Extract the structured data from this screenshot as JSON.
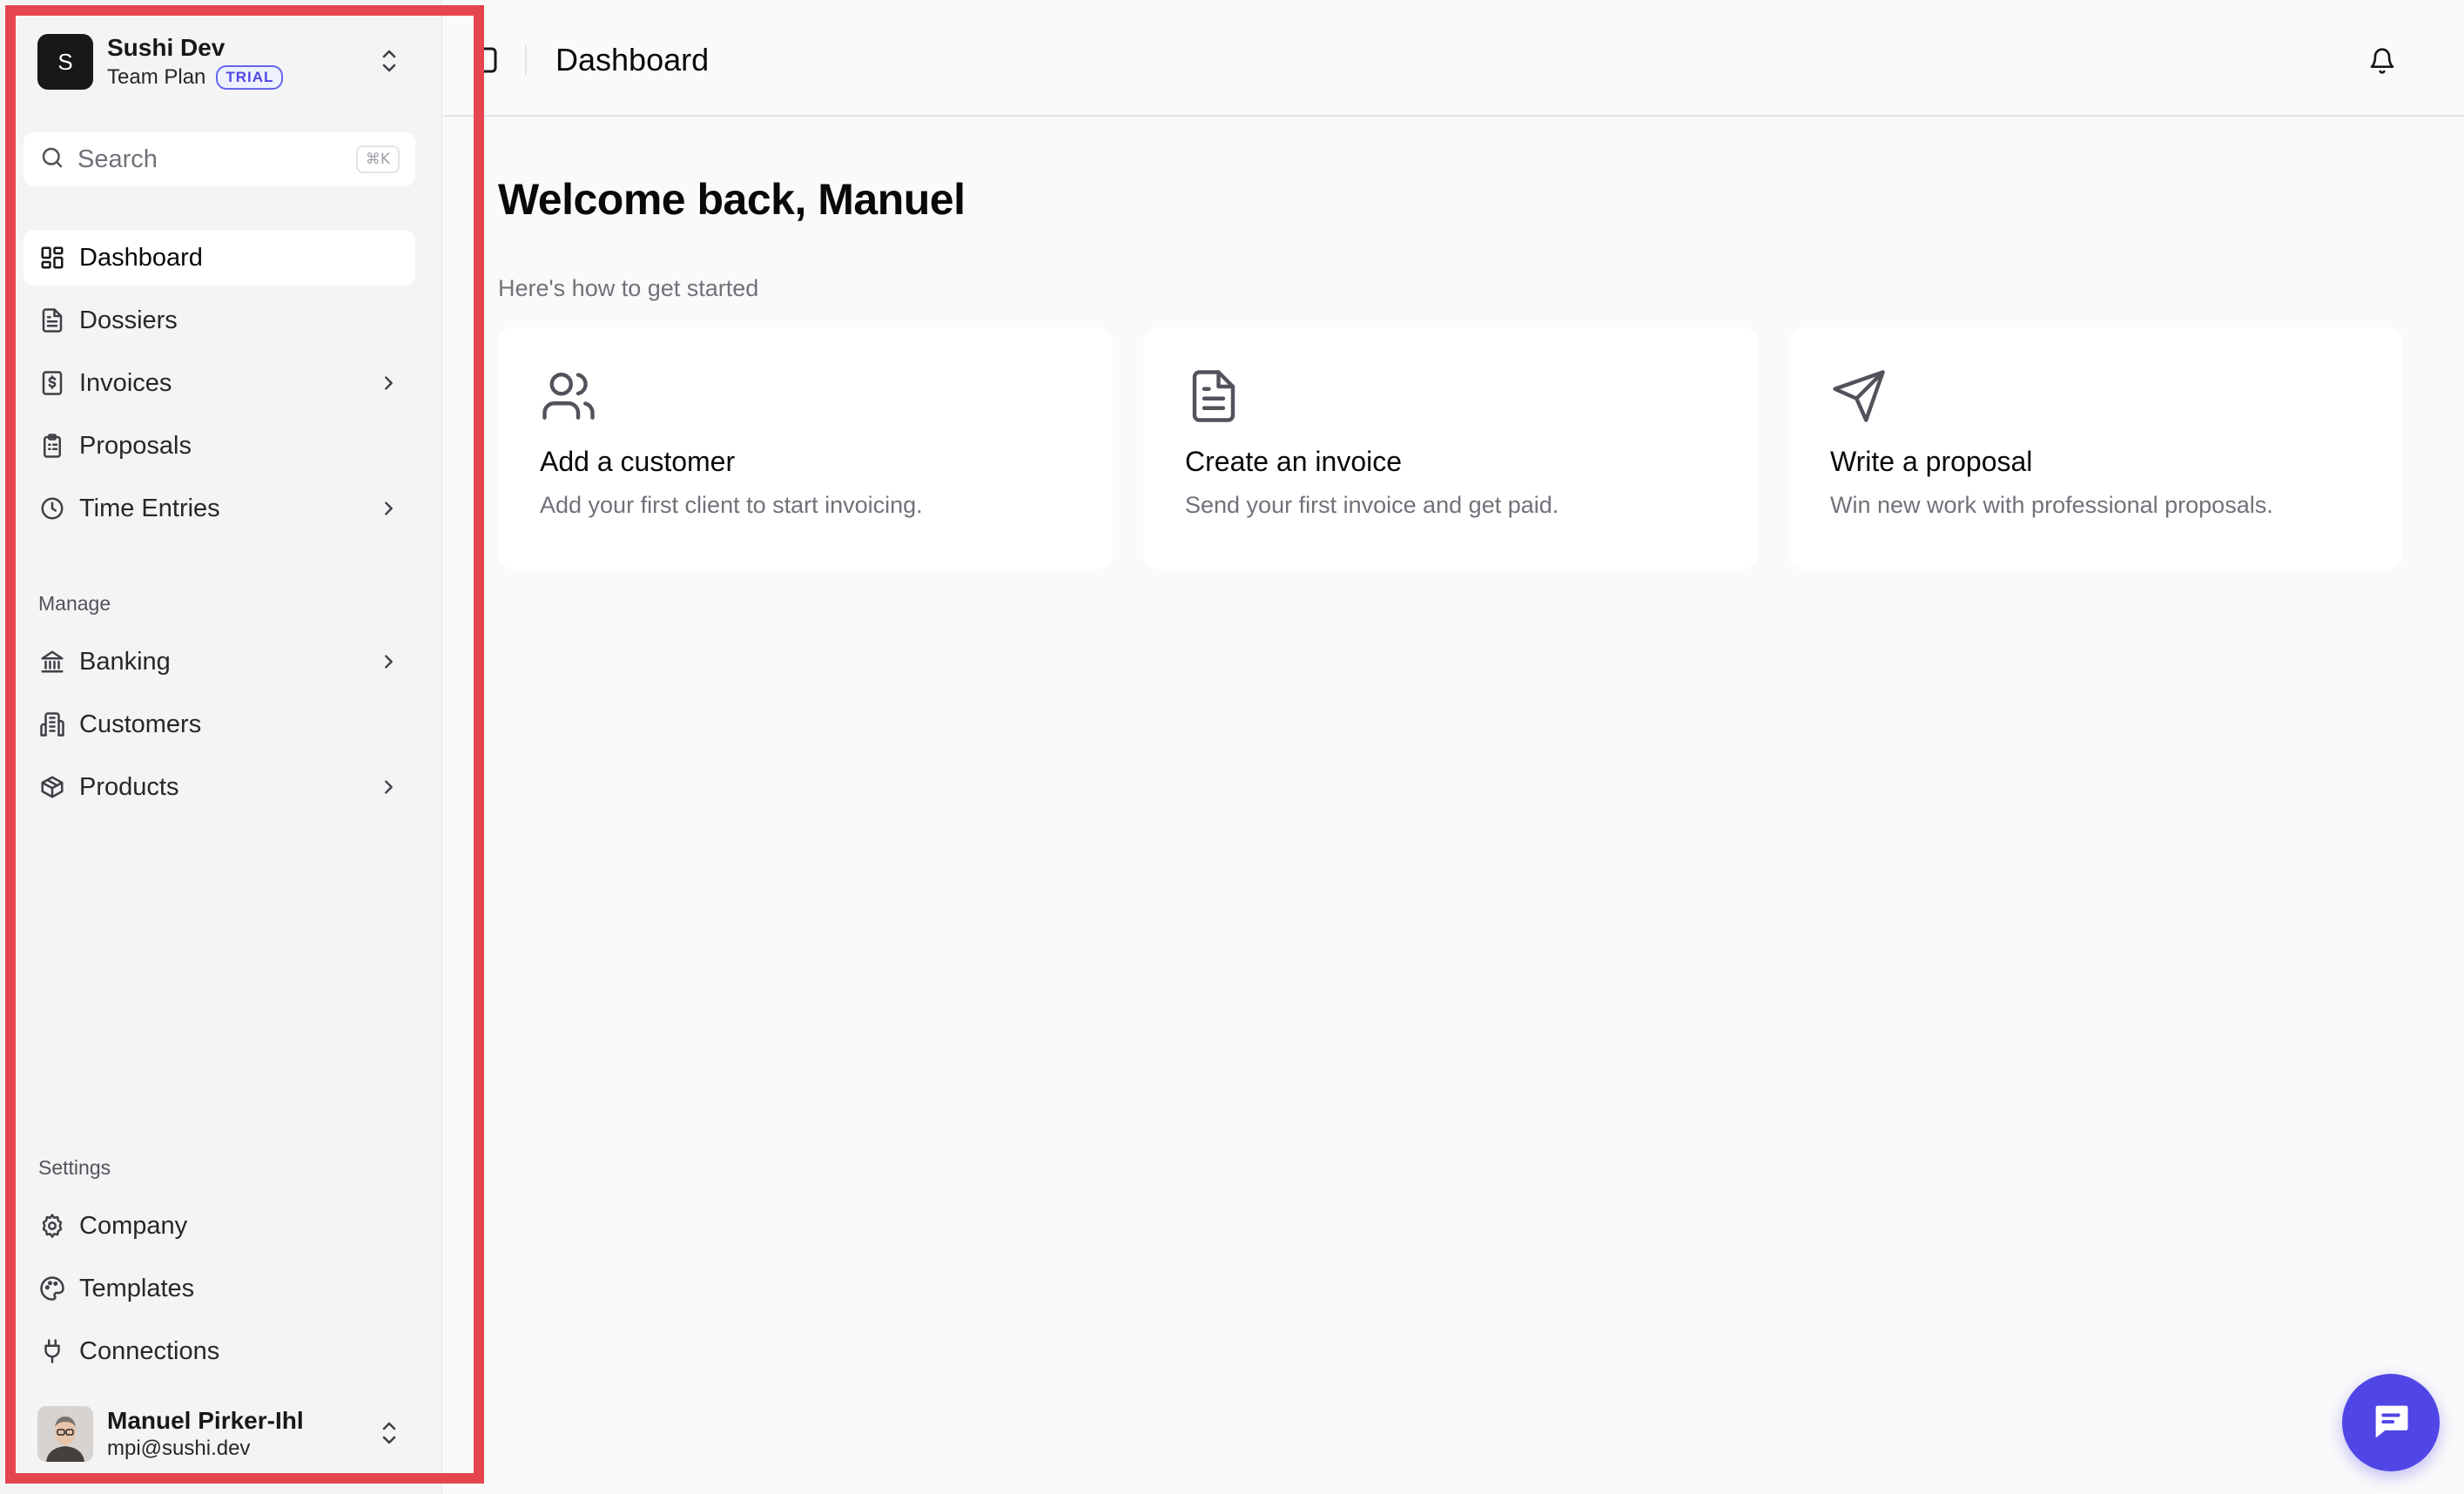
{
  "team": {
    "avatar_letter": "S",
    "name": "Sushi Dev",
    "plan": "Team Plan",
    "badge": "TRIAL"
  },
  "search": {
    "placeholder": "Search",
    "shortcut": "⌘K"
  },
  "nav": {
    "main": [
      {
        "label": "Dashboard",
        "icon": "layout-dashboard-icon",
        "active": true,
        "has_chevron": false
      },
      {
        "label": "Dossiers",
        "icon": "file-text-icon",
        "active": false,
        "has_chevron": false
      },
      {
        "label": "Invoices",
        "icon": "receipt-icon",
        "active": false,
        "has_chevron": true
      },
      {
        "label": "Proposals",
        "icon": "clipboard-list-icon",
        "active": false,
        "has_chevron": false
      },
      {
        "label": "Time Entries",
        "icon": "clock-icon",
        "active": false,
        "has_chevron": true
      }
    ],
    "manage_label": "Manage",
    "manage": [
      {
        "label": "Banking",
        "icon": "landmark-icon",
        "has_chevron": true
      },
      {
        "label": "Customers",
        "icon": "building-icon",
        "has_chevron": false
      },
      {
        "label": "Products",
        "icon": "package-icon",
        "has_chevron": true
      }
    ],
    "settings_label": "Settings",
    "settings": [
      {
        "label": "Company",
        "icon": "gear-icon"
      },
      {
        "label": "Templates",
        "icon": "palette-icon"
      },
      {
        "label": "Connections",
        "icon": "plug-icon"
      }
    ]
  },
  "user": {
    "name": "Manuel Pirker-Ihl",
    "email": "mpi@sushi.dev"
  },
  "header": {
    "title": "Dashboard"
  },
  "main": {
    "welcome": "Welcome back, Manuel",
    "subtitle": "Here's how to get started",
    "cards": [
      {
        "title": "Add a customer",
        "description": "Add your first client to start invoicing.",
        "icon": "users-icon"
      },
      {
        "title": "Create an invoice",
        "description": "Send your first invoice and get paid.",
        "icon": "file-text-icon"
      },
      {
        "title": "Write a proposal",
        "description": "Win new work with professional proposals.",
        "icon": "send-icon"
      }
    ]
  },
  "colors": {
    "accent": "#4f46e5",
    "highlight": "#e5454f",
    "sidebar_bg": "#f4f4f5",
    "page_bg": "#fafafa"
  }
}
